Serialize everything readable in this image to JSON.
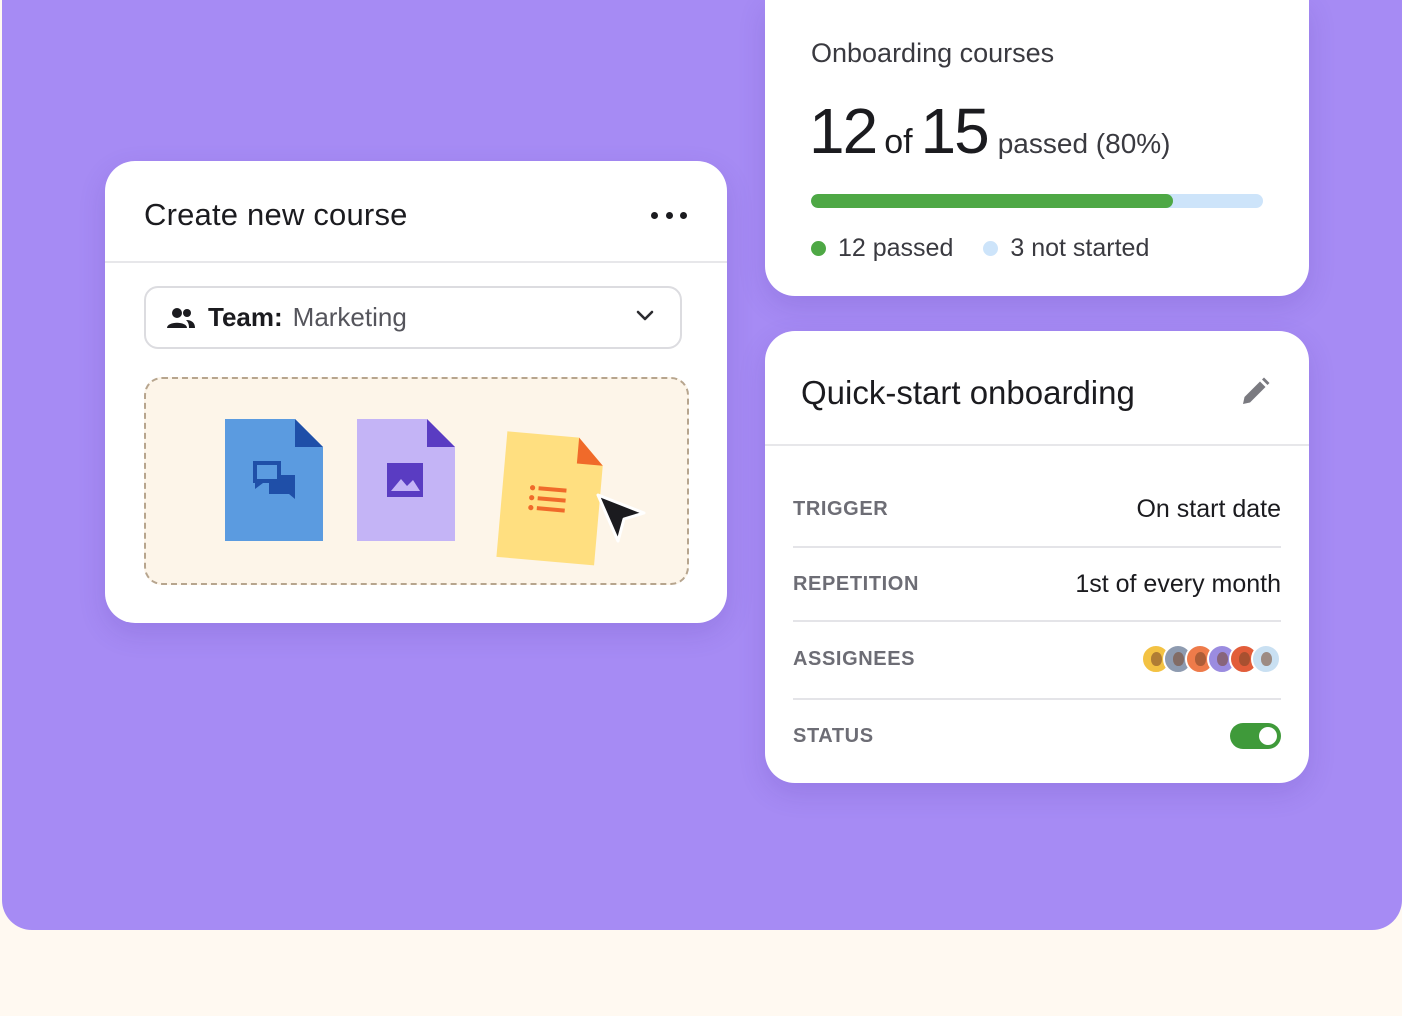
{
  "colors": {
    "stage_background": "#A68BF4",
    "page_background": "#FFF9F1",
    "progress_done": "#4EA845",
    "progress_remaining": "#CDE4FA",
    "status_on": "#3F9A3A"
  },
  "create_course": {
    "title": "Create new course",
    "more_icon": "more-horizontal-icon",
    "team": {
      "icon": "team-icon",
      "label": "Team:",
      "value": "Marketing"
    },
    "files": [
      {
        "type": "chat-document",
        "color": "#5B9BE0"
      },
      {
        "type": "image-document",
        "color": "#C4B4F6"
      },
      {
        "type": "list-document",
        "color": "#FFDF80"
      }
    ]
  },
  "onboarding": {
    "title": "Onboarding courses",
    "passed": "12",
    "of_word": "of",
    "total": "15",
    "passed_text": "passed (80%)",
    "progress_fraction": 0.8,
    "legend": {
      "passed": "12 passed",
      "not_started": "3 not started"
    }
  },
  "quick_start": {
    "title": "Quick-start onboarding",
    "edit_icon": "pencil-icon",
    "rows": [
      {
        "label": "TRIGGER",
        "value": "On start date"
      },
      {
        "label": "REPETITION",
        "value": "1st of every month"
      },
      {
        "label": "ASSIGNEES"
      },
      {
        "label": "STATUS",
        "status_on": true
      }
    ],
    "assignee_colors": [
      "#F3C243",
      "#8E9BB0",
      "#EE7B4A",
      "#9B8CE0",
      "#E25D3A",
      "#C9E0F2"
    ]
  }
}
